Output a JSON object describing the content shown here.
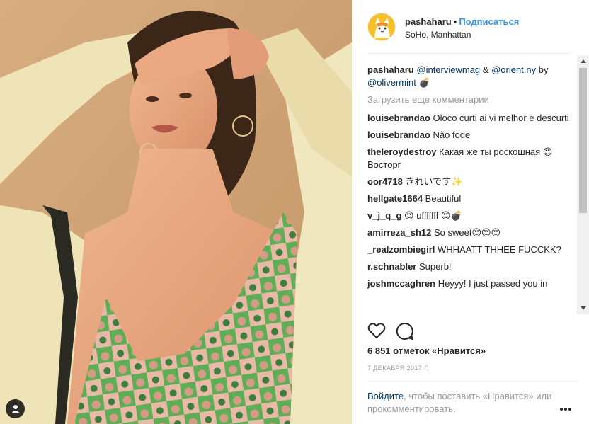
{
  "header": {
    "username": "pashaharu",
    "separator": "•",
    "follow_label": "Подписаться",
    "location": "SoHo, Manhattan"
  },
  "caption": {
    "username": "pashaharu",
    "mention1": "@interviewmag",
    "amp": "&",
    "mention2": "@orient.ny",
    "by": "by",
    "mention3": "@olivermint",
    "emoji": "💣"
  },
  "load_more_label": "Загрузить еще комментарии",
  "comments": [
    {
      "user": "louisebrandao",
      "text": "Oloco curti ai vi melhor e descurti"
    },
    {
      "user": "louisebrandao",
      "text": "Não fode"
    },
    {
      "user": "theleroydestroy",
      "text": "Какая же ты роскошная 😍 Восторг"
    },
    {
      "user": "oor4718",
      "text": "きれいです✨"
    },
    {
      "user": "hellgate1664",
      "text": "Beautiful"
    },
    {
      "user": "v_j_q_g",
      "text": "😍 ufffffff 😍💣"
    },
    {
      "user": "amirreza_sh12",
      "text": "So sweet😍😍😍"
    },
    {
      "user": "_realzombiegirl",
      "text": "WHHAATT THHEE FUCCKK?"
    },
    {
      "user": "r.schnabler",
      "text": "Superb!"
    },
    {
      "user": "joshmccaghren",
      "text": "Heyyy! I just passed you in"
    }
  ],
  "likes_text": "6 851 отметок «Нравится»",
  "date_text": "7 ДЕКАБРЯ 2017 Г.",
  "footer": {
    "login_link": "Войдите",
    "rest": ", чтобы поставить «Нравится» или прокомментировать."
  },
  "colors": {
    "link_blue": "#3897f0",
    "mention_navy": "#003569",
    "muted_gray": "#999999"
  },
  "icons": {
    "like": "heart-icon",
    "comment": "comment-icon",
    "more": "more-options-icon",
    "user_tag": "user-tag-icon"
  }
}
